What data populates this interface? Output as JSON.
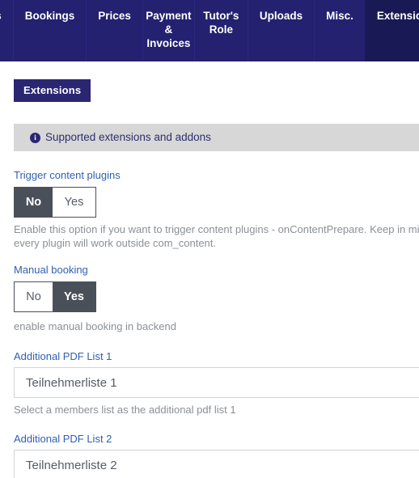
{
  "navbar": {
    "tabs": [
      {
        "label": "rses",
        "active": false,
        "clipped": true
      },
      {
        "label": "Bookings",
        "active": false
      },
      {
        "label": "Prices",
        "active": false
      },
      {
        "label": "Payment & Invoices",
        "active": false
      },
      {
        "label": "Tutor's Role",
        "active": false
      },
      {
        "label": "Uploads",
        "active": false
      },
      {
        "label": "Misc.",
        "active": false
      },
      {
        "label": "Extensions",
        "active": true
      }
    ]
  },
  "page": {
    "section_badge": "Extensions",
    "alert": {
      "icon": "info-circle-icon",
      "text": "Supported extensions and addons"
    },
    "fields": [
      {
        "key": "trigger_content_plugins",
        "label": "Trigger content plugins",
        "type": "toggle",
        "options": [
          "No",
          "Yes"
        ],
        "value": "No",
        "help": "Enable this option if you want to trigger content plugins - onContentPrepare. Keep in mind not every plugin will work outside com_content."
      },
      {
        "key": "manual_booking",
        "label": "Manual booking",
        "type": "toggle",
        "options": [
          "No",
          "Yes"
        ],
        "value": "Yes",
        "help": "enable manual booking in backend"
      },
      {
        "key": "additional_pdf_list_1",
        "label": "Additional PDF List 1",
        "type": "select",
        "value": "Teilnehmerliste 1",
        "help": "Select a members list as the additional pdf list 1"
      },
      {
        "key": "additional_pdf_list_2",
        "label": "Additional PDF List 2",
        "type": "select",
        "value": "Teilnehmerliste 2",
        "help": ""
      }
    ]
  },
  "colors": {
    "nav_bg": "#232170",
    "nav_active_bg": "#191a55",
    "badge_bg": "#2a2672",
    "alert_bg": "#d7d7d7",
    "alert_fg": "#2e2e6e",
    "label_blue": "#2f5fb3",
    "toggle_active_bg": "#4a5059",
    "help_gray": "#8b9096"
  }
}
